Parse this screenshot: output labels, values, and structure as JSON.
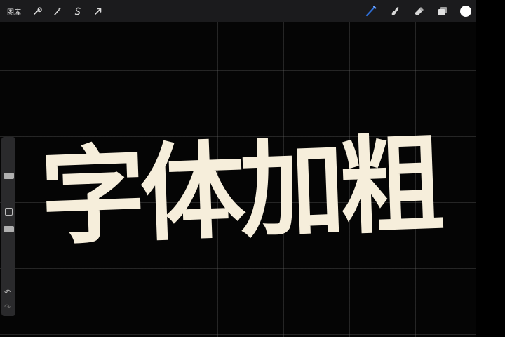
{
  "toolbar": {
    "gallery_label": "图库",
    "left_tools": [
      {
        "icon": "wrench-icon",
        "glyph": "🔧"
      },
      {
        "icon": "magic-wand-icon",
        "glyph": "✦"
      },
      {
        "icon": "selection-icon",
        "glyph": "S"
      },
      {
        "icon": "transform-arrow-icon",
        "glyph": "➚"
      }
    ],
    "right_tools": [
      {
        "icon": "brush-icon"
      },
      {
        "icon": "smudge-icon"
      },
      {
        "icon": "eraser-icon"
      },
      {
        "icon": "layers-icon"
      }
    ],
    "active_color": "#ffffff",
    "brush_accent": "#2e6fd8"
  },
  "sidebar": {
    "undo_glyph": "↶",
    "redo_glyph": "↷"
  },
  "canvas": {
    "text": "字体加粗",
    "text_color": "#f6eedb",
    "background": "#050505"
  }
}
